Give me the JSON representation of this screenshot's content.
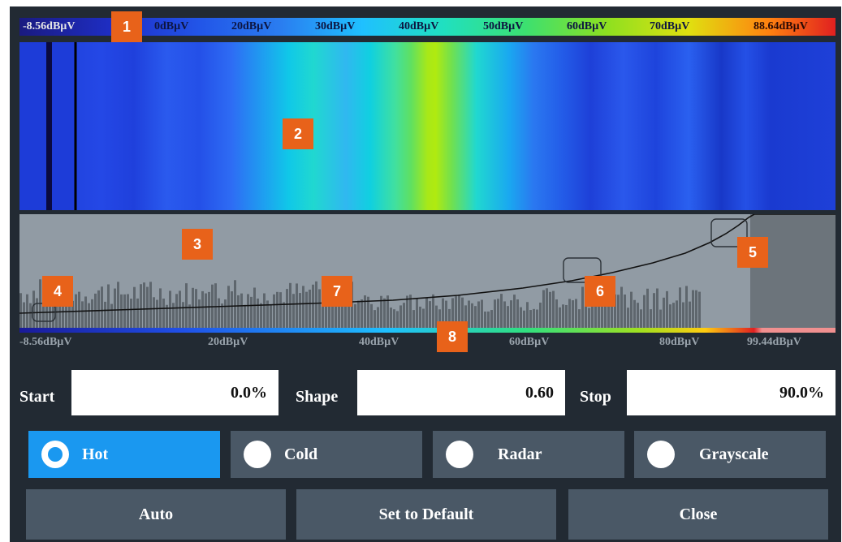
{
  "color_scale": {
    "labels": [
      "-8.56dBµV",
      "0dBµV",
      "20dBµV",
      "30dBµV",
      "40dBµV",
      "50dBµV",
      "60dBµV",
      "70dBµV",
      "88.64dBµV"
    ]
  },
  "histogram": {
    "axis_labels": [
      "-8.56dBµV",
      "20dBµV",
      "40dBµV",
      "60dBµV",
      "80dBµV",
      "99.44dBµV"
    ]
  },
  "callouts": [
    "1",
    "2",
    "3",
    "4",
    "5",
    "6",
    "7",
    "8"
  ],
  "fields": {
    "start": {
      "label": "Start",
      "value": "0.0%"
    },
    "shape": {
      "label": "Shape",
      "value": "0.60"
    },
    "stop": {
      "label": "Stop",
      "value": "90.0%"
    }
  },
  "color_schemes": [
    {
      "label": "Hot",
      "selected": true
    },
    {
      "label": "Cold",
      "selected": false
    },
    {
      "label": "Radar",
      "selected": false
    },
    {
      "label": "Grayscale",
      "selected": false
    }
  ],
  "buttons": {
    "auto": "Auto",
    "default": "Set to Default",
    "close": "Close"
  },
  "colors": {
    "dialog_bg": "#222a33",
    "accent_selected": "#1a98f0",
    "button_bg": "#4a5866",
    "callout": "#e8621a",
    "histogram_bg": "#919ba4"
  }
}
